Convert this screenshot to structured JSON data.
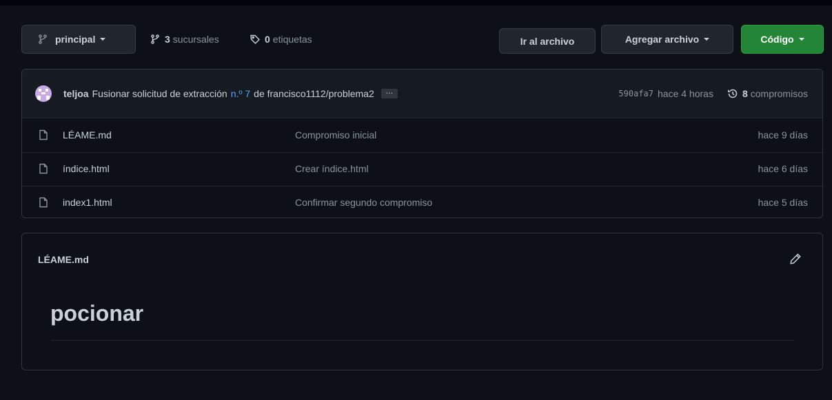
{
  "toolbar": {
    "branch_label": "principal",
    "branches_count": "3",
    "branches_label": "sucursales",
    "tags_count": "0",
    "tags_label": "etiquetas",
    "goto_file_label": "Ir al archivo",
    "add_file_label": "Agregar archivo",
    "code_label": "Código"
  },
  "commit": {
    "author": "teljoa",
    "message_before": "Fusionar solicitud de extracción",
    "pr_link": "n.º 7",
    "message_after": "de francisco1112/problema2",
    "ellipsis": "…",
    "sha": "590afa7",
    "time": "hace 4 horas",
    "commits_count": "8",
    "commits_label": "compromisos"
  },
  "files": [
    {
      "name": "LÉAME.md",
      "message": "Compromiso inicial",
      "age": "hace 9 días"
    },
    {
      "name": "índice.html",
      "message": "Crear índice.html",
      "age": "hace 6 días"
    },
    {
      "name": "index1.html",
      "message": "Confirmar segundo compromiso",
      "age": "hace 5 días"
    }
  ],
  "readme": {
    "filename": "LÉAME.md",
    "heading": "pocionar"
  },
  "colors": {
    "background": "#0d1117",
    "box_header": "#161b22",
    "border": "#30363d",
    "link": "#58a6ff",
    "primary_button": "#238636",
    "muted_text": "#8b949e"
  },
  "icons": {
    "branch": "git-branch-icon",
    "tag": "tag-icon",
    "history": "history-icon",
    "file": "file-icon",
    "edit": "pencil-icon"
  }
}
